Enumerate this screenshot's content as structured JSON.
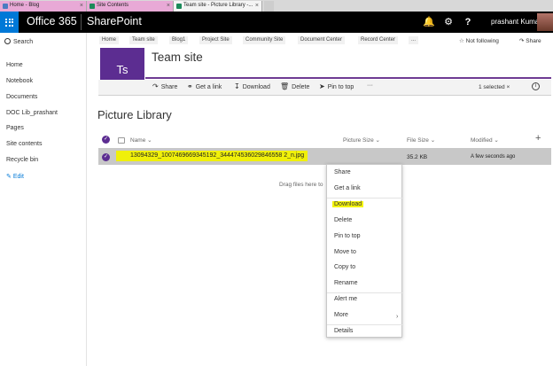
{
  "browser_tabs": [
    {
      "label": "Home - Blog",
      "color": "#4a7cc1"
    },
    {
      "label": "Site Contents",
      "color": "#1b8a5a"
    },
    {
      "label": "Team site - Picture Library -..."
    }
  ],
  "suite_bar": {
    "app_name": "Office 365",
    "site_name": "SharePoint",
    "user_name": "prashant Kumar",
    "icons": [
      "bell-icon",
      "gear-icon",
      "help-icon"
    ]
  },
  "left_nav": {
    "search_label": "Search",
    "items": [
      "Home",
      "Notebook",
      "Documents",
      "DOC Lib_prashant",
      "Pages",
      "Site contents",
      "Recycle bin"
    ],
    "edit_label": "Edit"
  },
  "site_nav": {
    "links": [
      "Home",
      "Team site",
      "Blog1",
      "Project Site",
      "Community Site",
      "Document Center",
      "Record Center",
      "..."
    ],
    "follow_label": "Not following",
    "share_label": "Share"
  },
  "site": {
    "logo_text": "Ts",
    "title": "Team site",
    "accent_color": "#5c2d91"
  },
  "command_bar": {
    "share": "Share",
    "get_link": "Get a link",
    "download": "Download",
    "delete": "Delete",
    "pin": "Pin to top",
    "more": "···",
    "selected": "1 selected"
  },
  "library": {
    "title": "Picture Library",
    "columns": {
      "name": "Name",
      "picture_size": "Picture Size",
      "file_size": "File Size",
      "modified": "Modified"
    },
    "rows": [
      {
        "name": "13094329_1007469669345192_344474536029846558 2_n.jpg",
        "file_size": "35.2 KB",
        "modified": "A few seconds ago"
      }
    ],
    "drag_hint": "Drag files here to"
  },
  "context_menu": {
    "items": [
      "Share",
      "Get a link",
      "Download",
      "Delete",
      "Pin to top",
      "Move to",
      "Copy to",
      "Rename",
      "Alert me",
      "More",
      "Details"
    ],
    "highlighted": "Download",
    "highlight_color": "#f4f40a"
  }
}
